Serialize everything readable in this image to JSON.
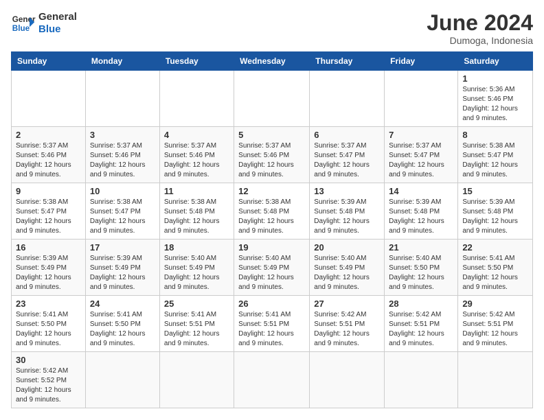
{
  "header": {
    "logo_general": "General",
    "logo_blue": "Blue",
    "title": "June 2024",
    "subtitle": "Dumoga, Indonesia"
  },
  "days_of_week": [
    "Sunday",
    "Monday",
    "Tuesday",
    "Wednesday",
    "Thursday",
    "Friday",
    "Saturday"
  ],
  "weeks": [
    {
      "days": [
        {
          "num": "",
          "info": "",
          "empty": true
        },
        {
          "num": "",
          "info": "",
          "empty": true
        },
        {
          "num": "",
          "info": "",
          "empty": true
        },
        {
          "num": "",
          "info": "",
          "empty": true
        },
        {
          "num": "",
          "info": "",
          "empty": true
        },
        {
          "num": "",
          "info": "",
          "empty": true
        },
        {
          "num": "1",
          "info": "Sunrise: 5:36 AM\nSunset: 5:46 PM\nDaylight: 12 hours and 9 minutes.",
          "empty": false
        }
      ]
    },
    {
      "days": [
        {
          "num": "2",
          "info": "Sunrise: 5:37 AM\nSunset: 5:46 PM\nDaylight: 12 hours and 9 minutes.",
          "empty": false
        },
        {
          "num": "3",
          "info": "Sunrise: 5:37 AM\nSunset: 5:46 PM\nDaylight: 12 hours and 9 minutes.",
          "empty": false
        },
        {
          "num": "4",
          "info": "Sunrise: 5:37 AM\nSunset: 5:46 PM\nDaylight: 12 hours and 9 minutes.",
          "empty": false
        },
        {
          "num": "5",
          "info": "Sunrise: 5:37 AM\nSunset: 5:46 PM\nDaylight: 12 hours and 9 minutes.",
          "empty": false
        },
        {
          "num": "6",
          "info": "Sunrise: 5:37 AM\nSunset: 5:47 PM\nDaylight: 12 hours and 9 minutes.",
          "empty": false
        },
        {
          "num": "7",
          "info": "Sunrise: 5:37 AM\nSunset: 5:47 PM\nDaylight: 12 hours and 9 minutes.",
          "empty": false
        },
        {
          "num": "8",
          "info": "Sunrise: 5:38 AM\nSunset: 5:47 PM\nDaylight: 12 hours and 9 minutes.",
          "empty": false
        }
      ]
    },
    {
      "days": [
        {
          "num": "9",
          "info": "Sunrise: 5:38 AM\nSunset: 5:47 PM\nDaylight: 12 hours and 9 minutes.",
          "empty": false
        },
        {
          "num": "10",
          "info": "Sunrise: 5:38 AM\nSunset: 5:47 PM\nDaylight: 12 hours and 9 minutes.",
          "empty": false
        },
        {
          "num": "11",
          "info": "Sunrise: 5:38 AM\nSunset: 5:48 PM\nDaylight: 12 hours and 9 minutes.",
          "empty": false
        },
        {
          "num": "12",
          "info": "Sunrise: 5:38 AM\nSunset: 5:48 PM\nDaylight: 12 hours and 9 minutes.",
          "empty": false
        },
        {
          "num": "13",
          "info": "Sunrise: 5:39 AM\nSunset: 5:48 PM\nDaylight: 12 hours and 9 minutes.",
          "empty": false
        },
        {
          "num": "14",
          "info": "Sunrise: 5:39 AM\nSunset: 5:48 PM\nDaylight: 12 hours and 9 minutes.",
          "empty": false
        },
        {
          "num": "15",
          "info": "Sunrise: 5:39 AM\nSunset: 5:48 PM\nDaylight: 12 hours and 9 minutes.",
          "empty": false
        }
      ]
    },
    {
      "days": [
        {
          "num": "16",
          "info": "Sunrise: 5:39 AM\nSunset: 5:49 PM\nDaylight: 12 hours and 9 minutes.",
          "empty": false
        },
        {
          "num": "17",
          "info": "Sunrise: 5:39 AM\nSunset: 5:49 PM\nDaylight: 12 hours and 9 minutes.",
          "empty": false
        },
        {
          "num": "18",
          "info": "Sunrise: 5:40 AM\nSunset: 5:49 PM\nDaylight: 12 hours and 9 minutes.",
          "empty": false
        },
        {
          "num": "19",
          "info": "Sunrise: 5:40 AM\nSunset: 5:49 PM\nDaylight: 12 hours and 9 minutes.",
          "empty": false
        },
        {
          "num": "20",
          "info": "Sunrise: 5:40 AM\nSunset: 5:49 PM\nDaylight: 12 hours and 9 minutes.",
          "empty": false
        },
        {
          "num": "21",
          "info": "Sunrise: 5:40 AM\nSunset: 5:50 PM\nDaylight: 12 hours and 9 minutes.",
          "empty": false
        },
        {
          "num": "22",
          "info": "Sunrise: 5:41 AM\nSunset: 5:50 PM\nDaylight: 12 hours and 9 minutes.",
          "empty": false
        }
      ]
    },
    {
      "days": [
        {
          "num": "23",
          "info": "Sunrise: 5:41 AM\nSunset: 5:50 PM\nDaylight: 12 hours and 9 minutes.",
          "empty": false
        },
        {
          "num": "24",
          "info": "Sunrise: 5:41 AM\nSunset: 5:50 PM\nDaylight: 12 hours and 9 minutes.",
          "empty": false
        },
        {
          "num": "25",
          "info": "Sunrise: 5:41 AM\nSunset: 5:51 PM\nDaylight: 12 hours and 9 minutes.",
          "empty": false
        },
        {
          "num": "26",
          "info": "Sunrise: 5:41 AM\nSunset: 5:51 PM\nDaylight: 12 hours and 9 minutes.",
          "empty": false
        },
        {
          "num": "27",
          "info": "Sunrise: 5:42 AM\nSunset: 5:51 PM\nDaylight: 12 hours and 9 minutes.",
          "empty": false
        },
        {
          "num": "28",
          "info": "Sunrise: 5:42 AM\nSunset: 5:51 PM\nDaylight: 12 hours and 9 minutes.",
          "empty": false
        },
        {
          "num": "29",
          "info": "Sunrise: 5:42 AM\nSunset: 5:51 PM\nDaylight: 12 hours and 9 minutes.",
          "empty": false
        }
      ]
    },
    {
      "days": [
        {
          "num": "30",
          "info": "Sunrise: 5:42 AM\nSunset: 5:52 PM\nDaylight: 12 hours and 9 minutes.",
          "empty": false
        },
        {
          "num": "",
          "info": "",
          "empty": true
        },
        {
          "num": "",
          "info": "",
          "empty": true
        },
        {
          "num": "",
          "info": "",
          "empty": true
        },
        {
          "num": "",
          "info": "",
          "empty": true
        },
        {
          "num": "",
          "info": "",
          "empty": true
        },
        {
          "num": "",
          "info": "",
          "empty": true
        }
      ]
    }
  ]
}
